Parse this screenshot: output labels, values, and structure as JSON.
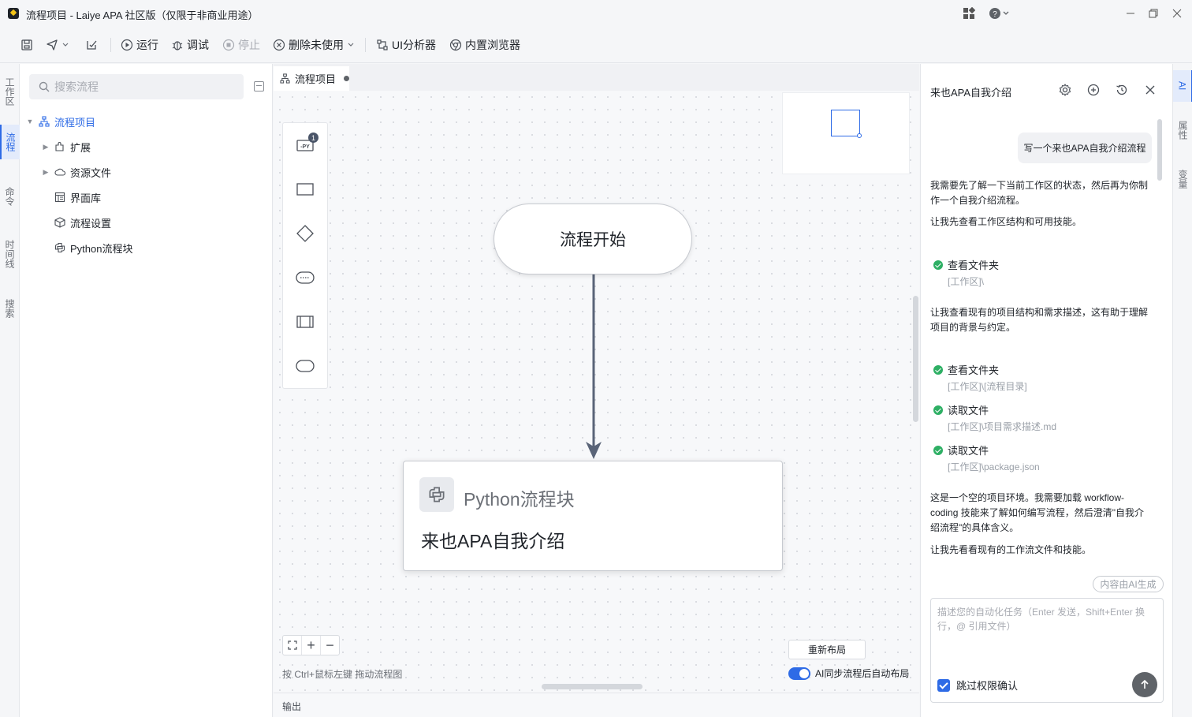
{
  "window": {
    "title": "流程项目 - Laiye APA 社区版（仅限于非商业用途）"
  },
  "toolbar": {
    "run": "运行",
    "debug": "调试",
    "stop": "停止",
    "delete_unused": "删除未使用",
    "ui_analyzer": "UI分析器",
    "browser": "内置浏览器"
  },
  "left_tabs": [
    "工作区",
    "流程",
    "命令",
    "时间线",
    "搜索"
  ],
  "left_panel": {
    "search_placeholder": "搜索流程",
    "tree": [
      {
        "label": "流程项目",
        "icon": "flow-project-icon"
      },
      {
        "label": "扩展",
        "icon": "extension-icon"
      },
      {
        "label": "资源文件",
        "icon": "cloud-icon"
      },
      {
        "label": "界面库",
        "icon": "ui-library-icon"
      },
      {
        "label": "流程设置",
        "icon": "cube-icon"
      },
      {
        "label": "Python流程块",
        "icon": "python-icon"
      }
    ]
  },
  "canvas": {
    "tab_label": "流程项目",
    "palette_badge": "1",
    "start_node": "流程开始",
    "python_block": {
      "type": "Python流程块",
      "title": "来也APA自我介绍"
    },
    "hint": "按 Ctrl+鼠标左键 拖动流程图",
    "relayout": "重新布局",
    "auto_layout_toggle": "AI同步流程后自动布局",
    "output": "输出"
  },
  "ai_panel": {
    "title": "来也APA自我介绍",
    "user_message": "写一个来也APA自我介绍流程",
    "messages": [
      "我需要先了解一下当前工作区的状态，然后再为你制作一个自我介绍流程。",
      "让我先查看工作区结构和可用技能。",
      "让我查看现有的项目结构和需求描述，这有助于理解项目的背景与约定。",
      "这是一个空的项目环境。我需要加载 workflow-coding 技能来了解如何编写流程，然后澄清\"自我介绍流程\"的具体含义。",
      "让我先看看现有的工作流文件和技能。"
    ],
    "tool_calls": [
      {
        "action": "查看文件夹",
        "path": "[工作区]\\"
      },
      {
        "action": "查看文件夹",
        "path": "[工作区]\\[流程目录]"
      },
      {
        "action": "读取文件",
        "path": "[工作区]\\项目需求描述.md"
      },
      {
        "action": "读取文件",
        "path": "[工作区]\\package.json"
      }
    ],
    "ai_generated": "内容由AI生成",
    "input_placeholder": "描述您的自动化任务（Enter 发送，Shift+Enter 换行，@ 引用文件）",
    "skip_permission": "跳过权限确认"
  },
  "right_tabs": [
    "AI",
    "属性",
    "变量"
  ],
  "colors": {
    "accent": "#2e6be6",
    "success": "#2eaf64"
  }
}
